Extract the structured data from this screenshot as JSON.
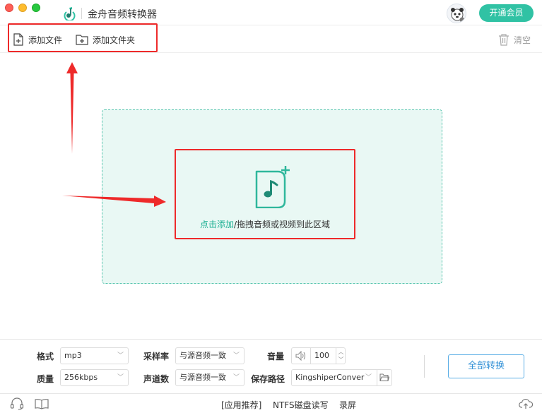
{
  "window": {
    "title": "金舟音频转换器",
    "vip_label": "开通会员"
  },
  "toolbar": {
    "add_file": "添加文件",
    "add_folder": "添加文件夹",
    "clear": "清空"
  },
  "dropzone": {
    "link_text": "点击添加",
    "rest_text": "/拖拽音频或视频到此区域"
  },
  "settings": {
    "format_label": "格式",
    "format_value": "mp3",
    "quality_label": "质量",
    "quality_value": "256kbps",
    "sample_rate_label": "采样率",
    "sample_rate_value": "与源音频一致",
    "channels_label": "声道数",
    "channels_value": "与源音频一致",
    "volume_label": "音量",
    "volume_value": "100",
    "save_path_label": "保存路径",
    "save_path_value": "KingshiperConver",
    "convert_all": "全部转换"
  },
  "statusbar": {
    "recommend": "[应用推荐]",
    "ntfs": "NTFS磁盘读写",
    "record": "录屏"
  },
  "colors": {
    "accent": "#30c2a4",
    "dropzone_bg": "#e9f8f4",
    "link": "#1db093",
    "annotation_red": "#ee2a2a",
    "convert_blue": "#2f8fd6"
  }
}
